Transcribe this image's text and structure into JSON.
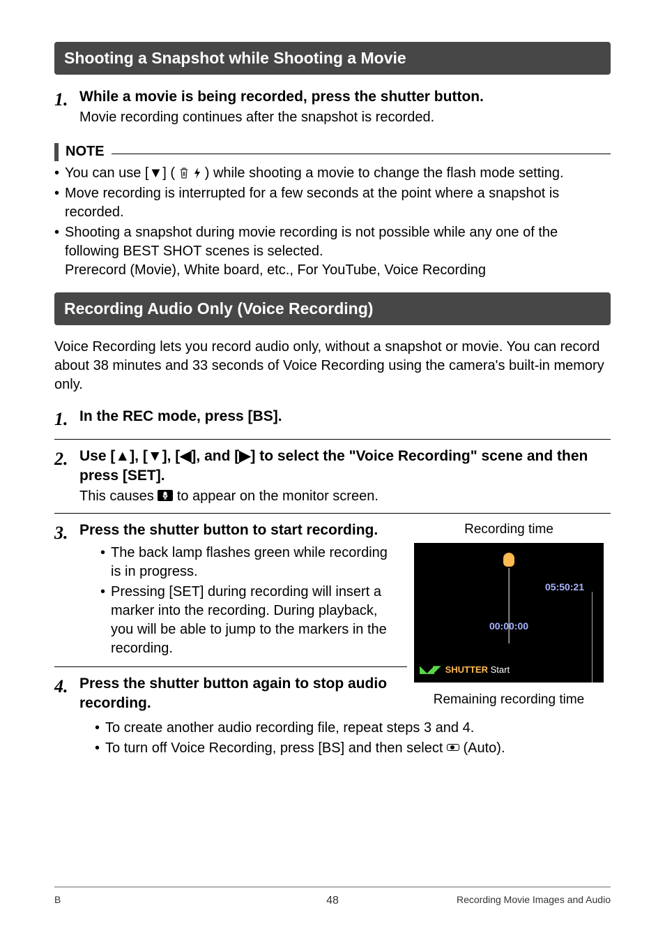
{
  "section1": {
    "title": "Shooting a Snapshot while Shooting a Movie",
    "step1": {
      "num": "1.",
      "title": "While a movie is being recorded, press the shutter button.",
      "text": "Movie recording continues after the snapshot is recorded."
    }
  },
  "note": {
    "label": "NOTE",
    "b1a": "You can use [",
    "b1b": "] (",
    "b1c": ") while shooting a movie to change the flash mode setting.",
    "b2": "Move recording is interrupted for a few seconds at the point where a snapshot is recorded.",
    "b3": "Shooting a snapshot during movie recording is not possible while any one of the following BEST SHOT scenes is selected.",
    "b3line2": "Prerecord (Movie), White board, etc., For YouTube, Voice Recording"
  },
  "section2": {
    "title": "Recording Audio Only (Voice Recording)",
    "intro": "Voice Recording lets you record audio only, without a snapshot or movie. You can record about 38 minutes and 33 seconds of Voice Recording using the camera's built-in memory only.",
    "step1": {
      "num": "1.",
      "title": "In the REC mode, press [BS]."
    },
    "step2": {
      "num": "2.",
      "title_a": "Use [",
      "title_b": "], [",
      "title_c": "], [",
      "title_d": "], and [",
      "title_e": "] to select the \"Voice Recording\" scene and then press [SET].",
      "text_a": "This causes ",
      "text_b": " to appear on the monitor screen."
    },
    "step3": {
      "num": "3.",
      "title": "Press the shutter button to start recording.",
      "b1": "The back lamp flashes green while recording is in progress.",
      "b2": "Pressing [SET] during recording will insert a marker into the recording. During playback, you will be able to jump to the markers in the recording."
    },
    "step4": {
      "num": "4.",
      "title": "Press the shutter button again to stop audio recording.",
      "b1": "To create another audio recording file, repeat steps 3 and 4.",
      "b2a": "To turn off Voice Recording, press [BS] and then select ",
      "b2b": " (Auto)."
    }
  },
  "screenshot": {
    "recording_time_label": "Recording time",
    "remaining_label": "Remaining recording time",
    "remaining_value": "05:50:21",
    "elapsed_value": "00:00:00",
    "shutter": "SHUTTER",
    "start": "Start"
  },
  "footer": {
    "left": "B",
    "page": "48",
    "right": "Recording Movie Images and Audio"
  }
}
